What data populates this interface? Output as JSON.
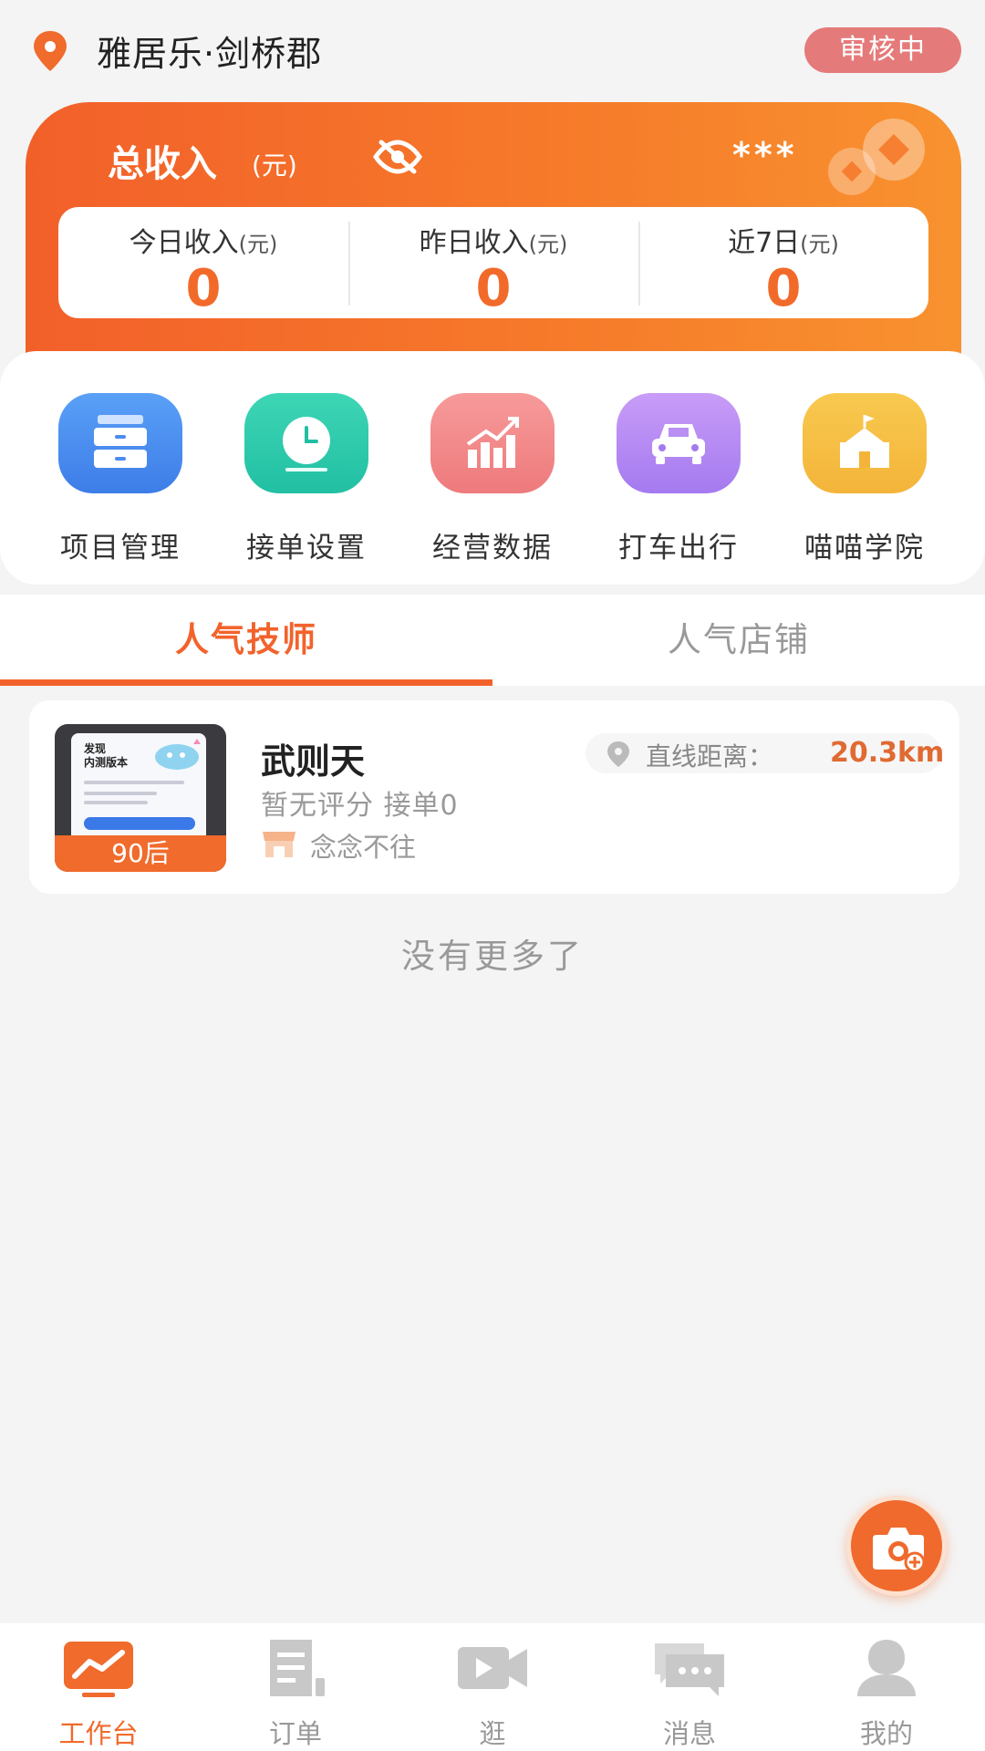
{
  "header": {
    "store_name": "雅居乐·剑桥郡",
    "status_badge": "审核中"
  },
  "income": {
    "title": "总收入",
    "unit": "(元)",
    "hidden_value": "***",
    "stats": [
      {
        "label": "今日收入",
        "unit": "(元)",
        "value": "0"
      },
      {
        "label": "昨日收入",
        "unit": "(元)",
        "value": "0"
      },
      {
        "label": "近7日",
        "unit": "(元)",
        "value": "0"
      }
    ]
  },
  "menu": [
    {
      "label": "项目管理",
      "icon": "drawer-icon",
      "color": "#4a8cf0"
    },
    {
      "label": "接单设置",
      "icon": "clock-icon",
      "color": "#2ccbae"
    },
    {
      "label": "经营数据",
      "icon": "chart-icon",
      "color": "#f28a8a"
    },
    {
      "label": "打车出行",
      "icon": "car-icon",
      "color": "#b285f0"
    },
    {
      "label": "喵喵学院",
      "icon": "school-icon",
      "color": "#f7c14a"
    }
  ],
  "tabs": [
    {
      "label": "人气技师",
      "active": true
    },
    {
      "label": "人气店铺",
      "active": false
    }
  ],
  "technician": {
    "name": "武则天",
    "rating": "暂无评分",
    "orders": "接单0",
    "shop": "念念不往",
    "age_tag": "90后",
    "distance_label": "直线距离：",
    "distance_value": "20.3km",
    "thumb_title": "发现\n内测版本"
  },
  "list_end": "没有更多了",
  "tabbar": [
    {
      "label": "工作台",
      "icon": "dashboard-icon",
      "active": true
    },
    {
      "label": "订单",
      "icon": "order-icon",
      "active": false
    },
    {
      "label": "逛",
      "icon": "video-icon",
      "active": false
    },
    {
      "label": "消息",
      "icon": "message-icon",
      "active": false
    },
    {
      "label": "我的",
      "icon": "profile-icon",
      "active": false
    }
  ],
  "colors": {
    "accent": "#f2632c",
    "badge": "#e57a7a",
    "background": "#f4f4f4"
  }
}
